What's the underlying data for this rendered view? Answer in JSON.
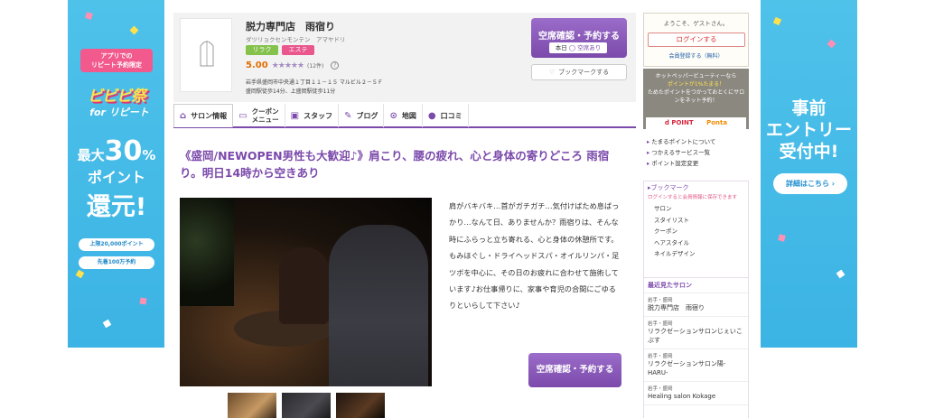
{
  "left_banner": {
    "app_label": "アプリでの\nリピート予約限定",
    "fest_title": "ビビビ祭",
    "fest_sub": "for リピート",
    "big_prefix": "最大",
    "big_number": "30",
    "big_unit": "%",
    "big_line2": "ポイント",
    "big_line3": "還元!",
    "pill_1": "上限20,000ポイント",
    "pill_2": "先着100万予約"
  },
  "right_banner": {
    "title_1": "事前",
    "title_2": "エントリー",
    "title_3": "受付中!",
    "button": "詳細はこちら ›"
  },
  "salon": {
    "name": "脱力専門店　雨宿り",
    "kana": "ダツリョクセンモンテン　アマヤドリ",
    "tags": [
      "リラク",
      "エステ"
    ],
    "rating": "5.00",
    "stars": "★★★★★",
    "review_count": "(12件)",
    "address": "岩手県盛岡市中央通１丁目１１－１５ マルビル２－５Ｆ",
    "access": "盛岡駅徒歩14分、上盛岡駅徒歩11分",
    "reserve_label": "空席確認・予約する",
    "today_label": "本日",
    "today_status": "◯ 空席あり",
    "bookmark_label": "ブックマークする"
  },
  "tabs": [
    {
      "label": "サロン情報"
    },
    {
      "label": "クーポン\nメニュー"
    },
    {
      "label": "スタッフ"
    },
    {
      "label": "ブログ"
    },
    {
      "label": "地図"
    },
    {
      "label": "口コミ"
    }
  ],
  "content": {
    "headline": "《盛岡/NEWOPEN男性も大歓迎♪》肩こり、腰の疲れ、心と身体の寄りどころ 雨宿り。明日14時から空きあり",
    "description": "肩がバキバキ…首がガチガチ…気付けばため息ばっかり…なんて日、ありませんか？雨宿りは、そんな時にふらっと立ち寄れる、心と身体の休憩所です。もみほぐし・ドライヘッドスパ・オイルリンパ・足ツボを中心に、その日のお疲れに合わせて施術しています♪お仕事帰りに、家事や育児の合間にごゆるりといらして下さい♪",
    "reserve_label": "空席確認・予約する"
  },
  "sidebar": {
    "welcome": "ようこそ、ゲストさん。",
    "login": "ログインする",
    "register": "会員登録する（無料）",
    "point_1": "ホットペッパービューティーなら",
    "point_2": "ポイントが1%たまる！",
    "point_3": "ためたポイントをつかっておとくにサロンをネット予約！",
    "dpoint": "d POINT",
    "ponta": "Ponta",
    "links": [
      "たまるポイントについて",
      "つかえるサービス一覧",
      "ポイント設定変更"
    ],
    "bookmark_title": "ブックマーク",
    "bookmark_note": "ログインすると会員情報に保存できます",
    "bookmark_items": [
      "サロン",
      "スタイリスト",
      "クーポン",
      "ヘアスタイル",
      "ネイルデザイン"
    ],
    "recent_title": "最近見たサロン",
    "recent": [
      {
        "area": "岩手・盛岡",
        "name": "脱力専門店　雨宿り"
      },
      {
        "area": "岩手・盛岡",
        "name": "リラクゼーションサロンじぇいこぶす"
      },
      {
        "area": "岩手・盛岡",
        "name": "リラクゼーションサロン陽-HARU-"
      },
      {
        "area": "岩手・盛岡",
        "name": "Healing salon Kokage"
      }
    ]
  }
}
